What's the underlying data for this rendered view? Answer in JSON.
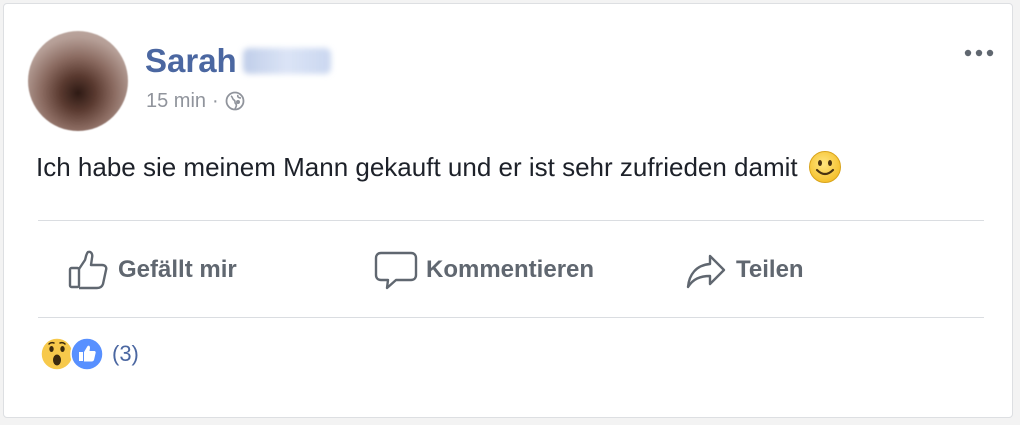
{
  "post": {
    "author_first_name": "Sarah",
    "time": "15 min",
    "separator": "·",
    "privacy_icon": "globe-icon",
    "text": "Ich habe sie meinem Mann gekauft und er ist sehr zufrieden damit",
    "emoji": "smiley-icon"
  },
  "actions": {
    "like_label": "Gefällt mir",
    "comment_label": "Kommentieren",
    "share_label": "Teilen"
  },
  "reactions": {
    "types": [
      "wow",
      "like"
    ],
    "count": "(3)"
  },
  "colors": {
    "brand": "#4b67a1",
    "action_text": "#606770",
    "like_blue": "#5890ff",
    "wow_yellow": "#f7c94b"
  }
}
